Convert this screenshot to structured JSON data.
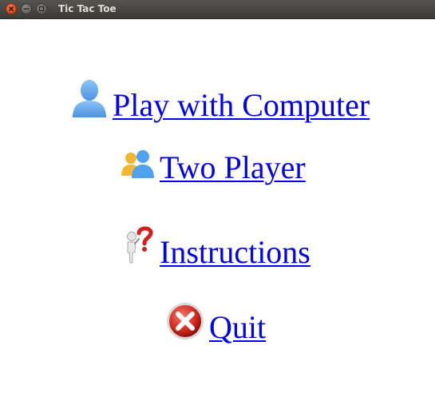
{
  "window": {
    "title": "Tic Tac Toe"
  },
  "menu": {
    "items": [
      {
        "label": "Play with Computer",
        "icon": "single-user-icon"
      },
      {
        "label": "Two Player",
        "icon": "two-users-icon"
      },
      {
        "label": "Instructions",
        "icon": "question-person-icon"
      },
      {
        "label": "Quit",
        "icon": "quit-x-icon"
      }
    ]
  },
  "colors": {
    "link": "#0000ee",
    "close_button": "#e0521f",
    "titlebar": "#3c3b37",
    "user_icon": "#6aaaf0"
  }
}
